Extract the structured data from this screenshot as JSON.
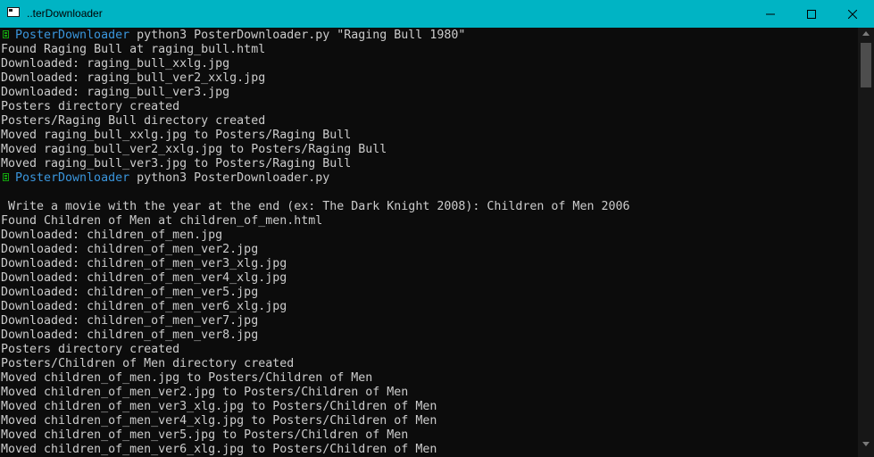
{
  "window": {
    "title": "..terDownloader",
    "buttons": {
      "minimize": "minimize",
      "maximize": "maximize",
      "close": "close"
    },
    "colors": {
      "titlebar": "#00b4c4",
      "background": "#0c0c0c",
      "text": "#cccccc",
      "prompt_dir": "#3a96dd",
      "prompt_icon": "#13a10e"
    }
  },
  "terminal": {
    "lines": [
      {
        "type": "prompt",
        "dir": "PosterDownloader",
        "cmd": " python3 PosterDownloader.py \"Raging Bull 1980\""
      },
      {
        "type": "output",
        "text": "Found Raging Bull at raging_bull.html"
      },
      {
        "type": "output",
        "text": "Downloaded: raging_bull_xxlg.jpg"
      },
      {
        "type": "output",
        "text": "Downloaded: raging_bull_ver2_xxlg.jpg"
      },
      {
        "type": "output",
        "text": "Downloaded: raging_bull_ver3.jpg"
      },
      {
        "type": "output",
        "text": "Posters directory created"
      },
      {
        "type": "output",
        "text": "Posters/Raging Bull directory created"
      },
      {
        "type": "output",
        "text": "Moved raging_bull_xxlg.jpg to Posters/Raging Bull"
      },
      {
        "type": "output",
        "text": "Moved raging_bull_ver2_xxlg.jpg to Posters/Raging Bull"
      },
      {
        "type": "output",
        "text": "Moved raging_bull_ver3.jpg to Posters/Raging Bull"
      },
      {
        "type": "prompt",
        "dir": "PosterDownloader",
        "cmd": " python3 PosterDownloader.py"
      },
      {
        "type": "output",
        "text": ""
      },
      {
        "type": "output",
        "text": " Write a movie with the year at the end (ex: The Dark Knight 2008): Children of Men 2006"
      },
      {
        "type": "output",
        "text": "Found Children of Men at children_of_men.html"
      },
      {
        "type": "output",
        "text": "Downloaded: children_of_men.jpg"
      },
      {
        "type": "output",
        "text": "Downloaded: children_of_men_ver2.jpg"
      },
      {
        "type": "output",
        "text": "Downloaded: children_of_men_ver3_xlg.jpg"
      },
      {
        "type": "output",
        "text": "Downloaded: children_of_men_ver4_xlg.jpg"
      },
      {
        "type": "output",
        "text": "Downloaded: children_of_men_ver5.jpg"
      },
      {
        "type": "output",
        "text": "Downloaded: children_of_men_ver6_xlg.jpg"
      },
      {
        "type": "output",
        "text": "Downloaded: children_of_men_ver7.jpg"
      },
      {
        "type": "output",
        "text": "Downloaded: children_of_men_ver8.jpg"
      },
      {
        "type": "output",
        "text": "Posters directory created"
      },
      {
        "type": "output",
        "text": "Posters/Children of Men directory created"
      },
      {
        "type": "output",
        "text": "Moved children_of_men.jpg to Posters/Children of Men"
      },
      {
        "type": "output",
        "text": "Moved children_of_men_ver2.jpg to Posters/Children of Men"
      },
      {
        "type": "output",
        "text": "Moved children_of_men_ver3_xlg.jpg to Posters/Children of Men"
      },
      {
        "type": "output",
        "text": "Moved children_of_men_ver4_xlg.jpg to Posters/Children of Men"
      },
      {
        "type": "output",
        "text": "Moved children_of_men_ver5.jpg to Posters/Children of Men"
      },
      {
        "type": "output",
        "text": "Moved children_of_men_ver6_xlg.jpg to Posters/Children of Men"
      }
    ]
  }
}
